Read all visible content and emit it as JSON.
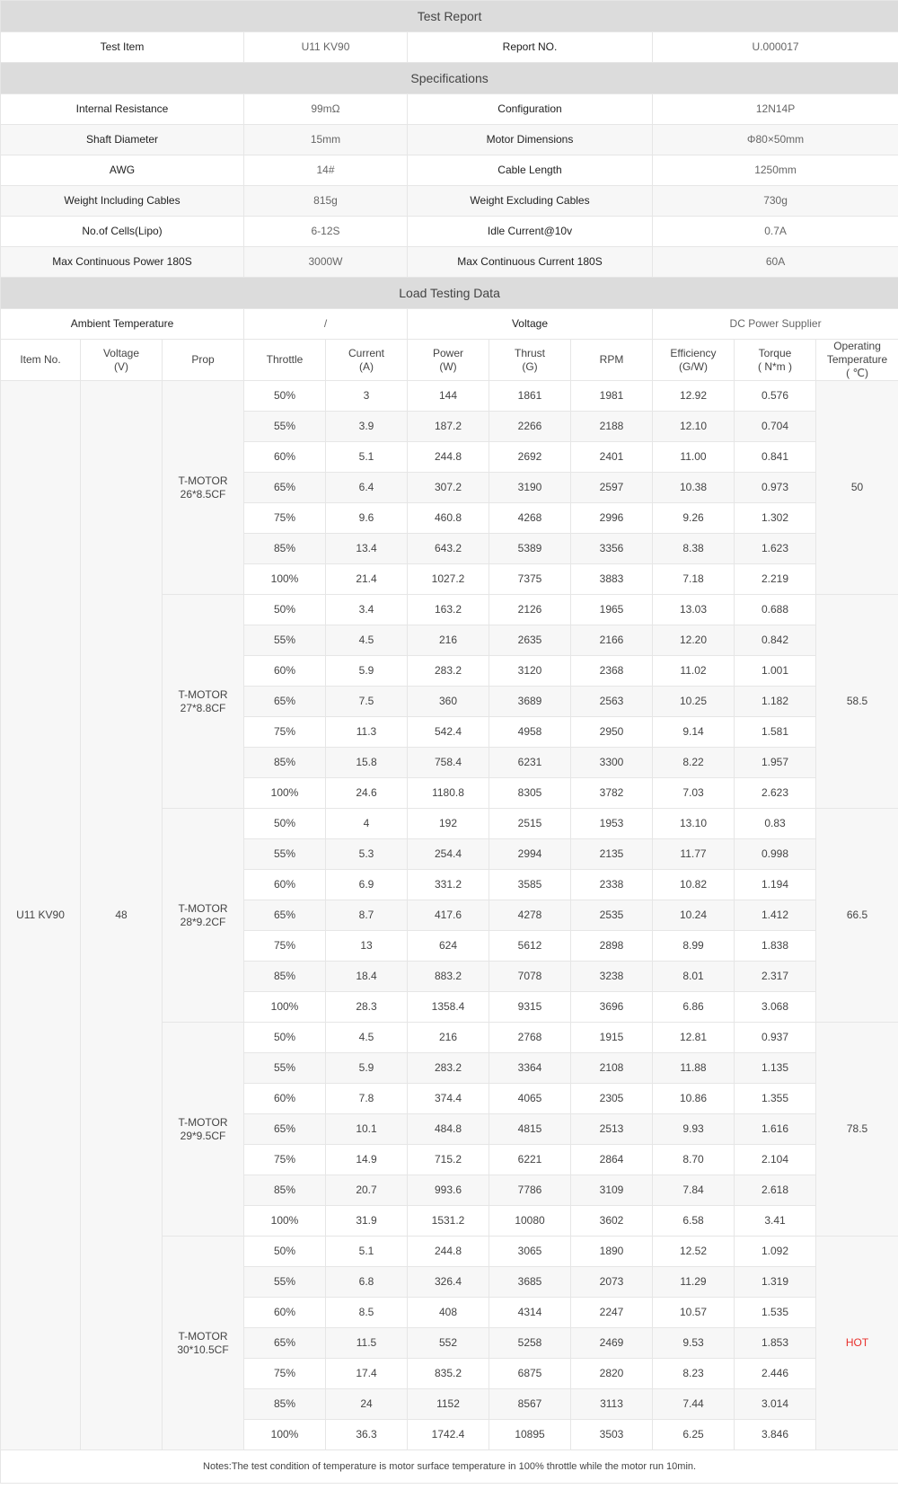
{
  "test_report": {
    "title": "Test Report",
    "test_item_label": "Test Item",
    "test_item_value": "U11 KV90",
    "report_no_label": "Report NO.",
    "report_no_value": "U.000017"
  },
  "specifications": {
    "title": "Specifications",
    "rows": [
      [
        "Internal Resistance",
        "99mΩ",
        "Configuration",
        "12N14P"
      ],
      [
        "Shaft Diameter",
        "15mm",
        "Motor Dimensions",
        "Φ80×50mm"
      ],
      [
        "AWG",
        "14#",
        "Cable Length",
        "1250mm"
      ],
      [
        "Weight Including Cables",
        "815g",
        "Weight Excluding Cables",
        "730g"
      ],
      [
        "No.of Cells(Lipo)",
        "6-12S",
        "Idle Current@10v",
        "0.7A"
      ],
      [
        "Max Continuous Power 180S",
        "3000W",
        "Max Continuous Current 180S",
        "60A"
      ]
    ]
  },
  "load_testing": {
    "title": "Load Testing Data",
    "ambient_label": "Ambient Temperature",
    "ambient_value": "/",
    "voltage_label": "Voltage",
    "voltage_value": "DC Power Supplier",
    "headers": [
      [
        "Item No."
      ],
      [
        "Voltage",
        "(V)"
      ],
      [
        "Prop"
      ],
      [
        "Throttle"
      ],
      [
        "Current",
        "(A)"
      ],
      [
        "Power",
        "(W)"
      ],
      [
        "Thrust",
        "(G)"
      ],
      [
        "RPM"
      ],
      [
        "Efficiency",
        "(G/W)"
      ],
      [
        "Torque",
        "( N*m )"
      ],
      [
        "Operating",
        "Temperature",
        "( ℃)"
      ]
    ],
    "item_no": "U11 KV90",
    "voltage": "48",
    "props": [
      {
        "name": [
          "T-MOTOR",
          "26*8.5CF"
        ],
        "temp": "50",
        "rows": [
          [
            "50%",
            "3",
            "144",
            "1861",
            "1981",
            "12.92",
            "0.576"
          ],
          [
            "55%",
            "3.9",
            "187.2",
            "2266",
            "2188",
            "12.10",
            "0.704"
          ],
          [
            "60%",
            "5.1",
            "244.8",
            "2692",
            "2401",
            "11.00",
            "0.841"
          ],
          [
            "65%",
            "6.4",
            "307.2",
            "3190",
            "2597",
            "10.38",
            "0.973"
          ],
          [
            "75%",
            "9.6",
            "460.8",
            "4268",
            "2996",
            "9.26",
            "1.302"
          ],
          [
            "85%",
            "13.4",
            "643.2",
            "5389",
            "3356",
            "8.38",
            "1.623"
          ],
          [
            "100%",
            "21.4",
            "1027.2",
            "7375",
            "3883",
            "7.18",
            "2.219"
          ]
        ]
      },
      {
        "name": [
          "T-MOTOR",
          "27*8.8CF"
        ],
        "temp": "58.5",
        "rows": [
          [
            "50%",
            "3.4",
            "163.2",
            "2126",
            "1965",
            "13.03",
            "0.688"
          ],
          [
            "55%",
            "4.5",
            "216",
            "2635",
            "2166",
            "12.20",
            "0.842"
          ],
          [
            "60%",
            "5.9",
            "283.2",
            "3120",
            "2368",
            "11.02",
            "1.001"
          ],
          [
            "65%",
            "7.5",
            "360",
            "3689",
            "2563",
            "10.25",
            "1.182"
          ],
          [
            "75%",
            "11.3",
            "542.4",
            "4958",
            "2950",
            "9.14",
            "1.581"
          ],
          [
            "85%",
            "15.8",
            "758.4",
            "6231",
            "3300",
            "8.22",
            "1.957"
          ],
          [
            "100%",
            "24.6",
            "1180.8",
            "8305",
            "3782",
            "7.03",
            "2.623"
          ]
        ]
      },
      {
        "name": [
          "T-MOTOR",
          "28*9.2CF"
        ],
        "temp": "66.5",
        "rows": [
          [
            "50%",
            "4",
            "192",
            "2515",
            "1953",
            "13.10",
            "0.83"
          ],
          [
            "55%",
            "5.3",
            "254.4",
            "2994",
            "2135",
            "11.77",
            "0.998"
          ],
          [
            "60%",
            "6.9",
            "331.2",
            "3585",
            "2338",
            "10.82",
            "1.194"
          ],
          [
            "65%",
            "8.7",
            "417.6",
            "4278",
            "2535",
            "10.24",
            "1.412"
          ],
          [
            "75%",
            "13",
            "624",
            "5612",
            "2898",
            "8.99",
            "1.838"
          ],
          [
            "85%",
            "18.4",
            "883.2",
            "7078",
            "3238",
            "8.01",
            "2.317"
          ],
          [
            "100%",
            "28.3",
            "1358.4",
            "9315",
            "3696",
            "6.86",
            "3.068"
          ]
        ]
      },
      {
        "name": [
          "T-MOTOR",
          "29*9.5CF"
        ],
        "temp": "78.5",
        "rows": [
          [
            "50%",
            "4.5",
            "216",
            "2768",
            "1915",
            "12.81",
            "0.937"
          ],
          [
            "55%",
            "5.9",
            "283.2",
            "3364",
            "2108",
            "11.88",
            "1.135"
          ],
          [
            "60%",
            "7.8",
            "374.4",
            "4065",
            "2305",
            "10.86",
            "1.355"
          ],
          [
            "65%",
            "10.1",
            "484.8",
            "4815",
            "2513",
            "9.93",
            "1.616"
          ],
          [
            "75%",
            "14.9",
            "715.2",
            "6221",
            "2864",
            "8.70",
            "2.104"
          ],
          [
            "85%",
            "20.7",
            "993.6",
            "7786",
            "3109",
            "7.84",
            "2.618"
          ],
          [
            "100%",
            "31.9",
            "1531.2",
            "10080",
            "3602",
            "6.58",
            "3.41"
          ]
        ]
      },
      {
        "name": [
          "T-MOTOR",
          "30*10.5CF"
        ],
        "temp": "HOT",
        "temp_color": "#e8302c",
        "rows": [
          [
            "50%",
            "5.1",
            "244.8",
            "3065",
            "1890",
            "12.52",
            "1.092"
          ],
          [
            "55%",
            "6.8",
            "326.4",
            "3685",
            "2073",
            "11.29",
            "1.319"
          ],
          [
            "60%",
            "8.5",
            "408",
            "4314",
            "2247",
            "10.57",
            "1.535"
          ],
          [
            "65%",
            "11.5",
            "552",
            "5258",
            "2469",
            "9.53",
            "1.853"
          ],
          [
            "75%",
            "17.4",
            "835.2",
            "6875",
            "2820",
            "8.23",
            "2.446"
          ],
          [
            "85%",
            "24",
            "1152",
            "8567",
            "3113",
            "7.44",
            "3.014"
          ],
          [
            "100%",
            "36.3",
            "1742.4",
            "10895",
            "3503",
            "6.25",
            "3.846"
          ]
        ]
      }
    ]
  },
  "notes": "Notes:The test condition of temperature is motor surface temperature in 100% throttle while the motor run 10min.",
  "colors": {
    "section_bg": "#dcdcdc",
    "alt_row_bg": "#f7f7f7",
    "border": "#e6e6e6",
    "hot": "#e8302c",
    "notes": "#e58a3a"
  }
}
